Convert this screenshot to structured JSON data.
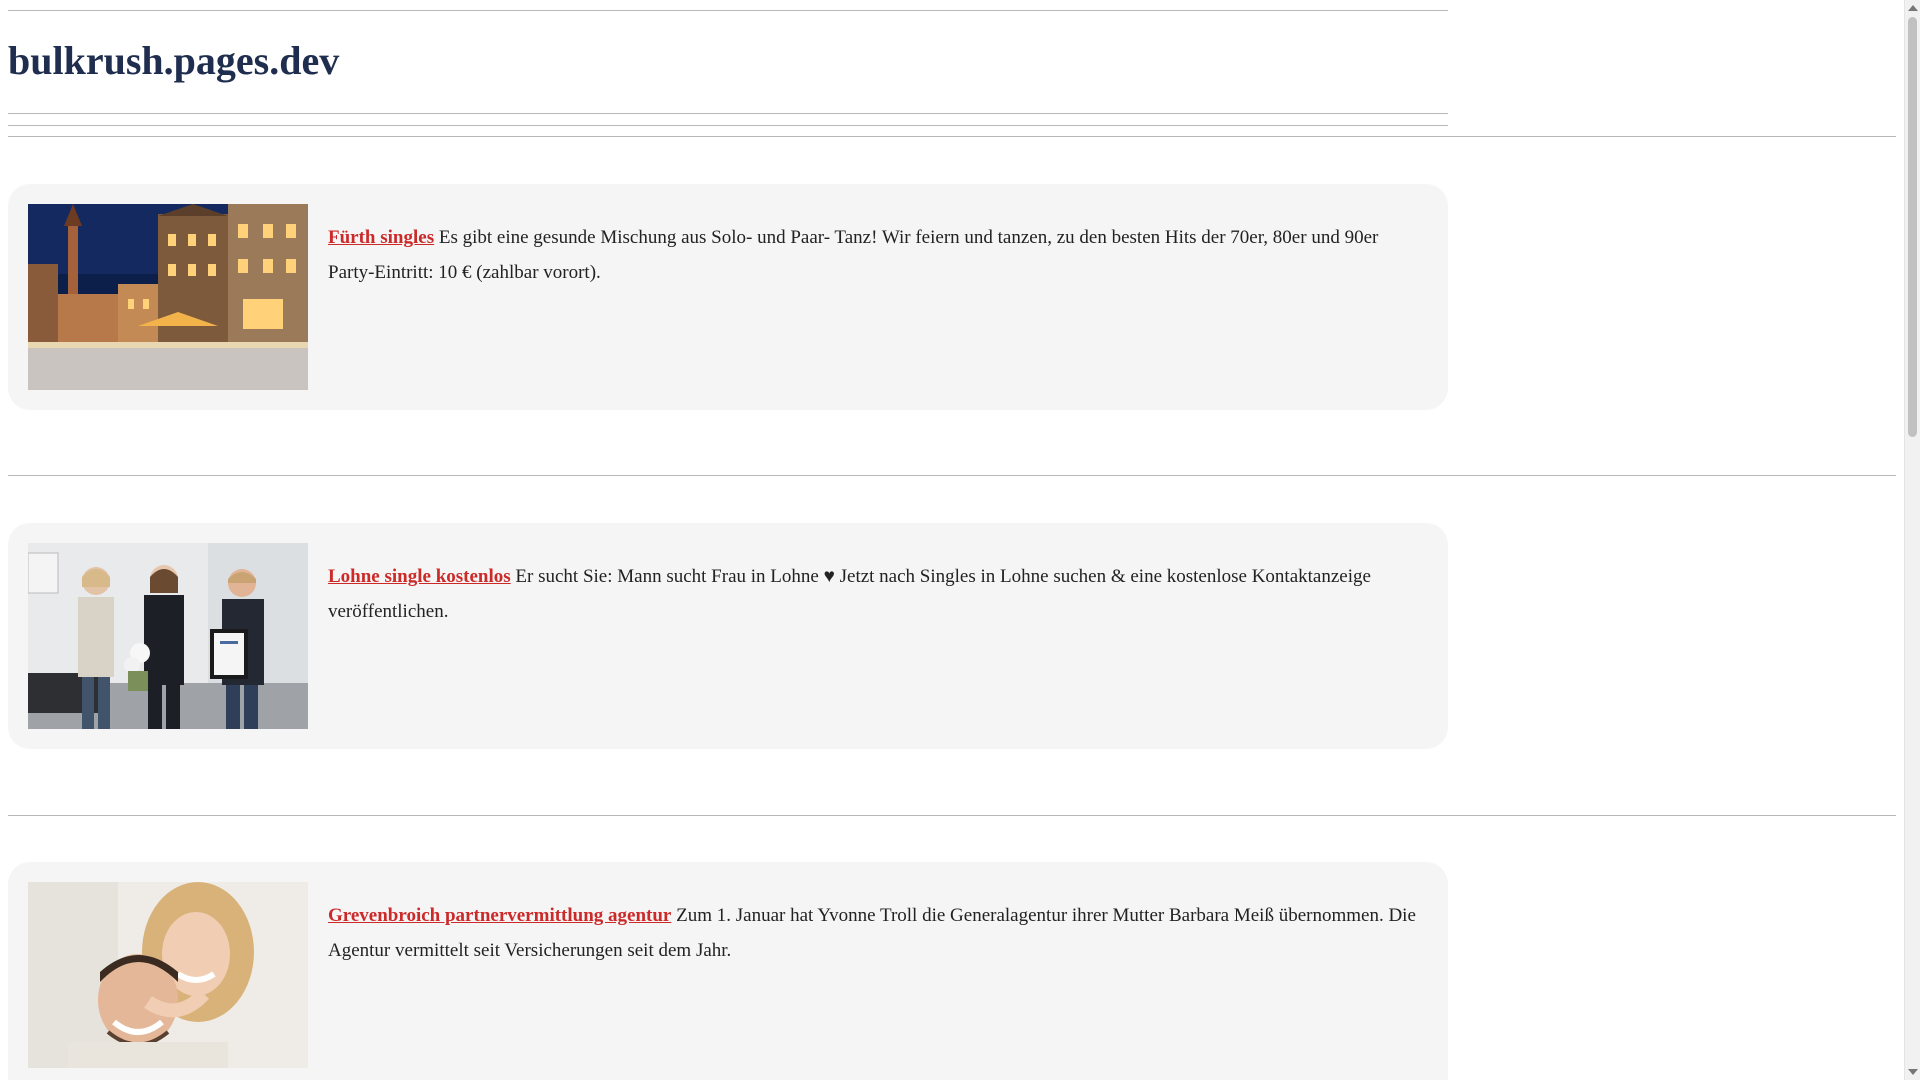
{
  "header": {
    "site_title": "bulkrush.pages.dev"
  },
  "posts": [
    {
      "title": "Fürth singles",
      "text": "Es gibt eine gesunde Mischung aus Solo- und Paar- Tanz! Wir feiern und tanzen, zu den besten Hits der 70er, 80er und 90er Party-Eintritt: 10 € (zahlbar vorort).",
      "image": "night-town-square-image"
    },
    {
      "title": "Lohne single kostenlos",
      "text": "Er sucht Sie: Mann sucht Frau in Lohne ♥ Jetzt nach Singles in Lohne suchen & eine kostenlose Kontaktanzeige veröffentlichen.",
      "image": "three-people-award-image"
    },
    {
      "title": "Grevenbroich partnervermittlung agentur",
      "text": "Zum 1. Januar hat Yvonne Troll die Generalagentur ihrer Mutter Barbara Meiß übernommen. Die Agentur vermittelt seit Versicherungen seit dem Jahr.",
      "image": "happy-couple-image"
    }
  ],
  "colors": {
    "link": "#cc2929",
    "title": "#1f2d4f",
    "card": "#f5f5f5"
  }
}
